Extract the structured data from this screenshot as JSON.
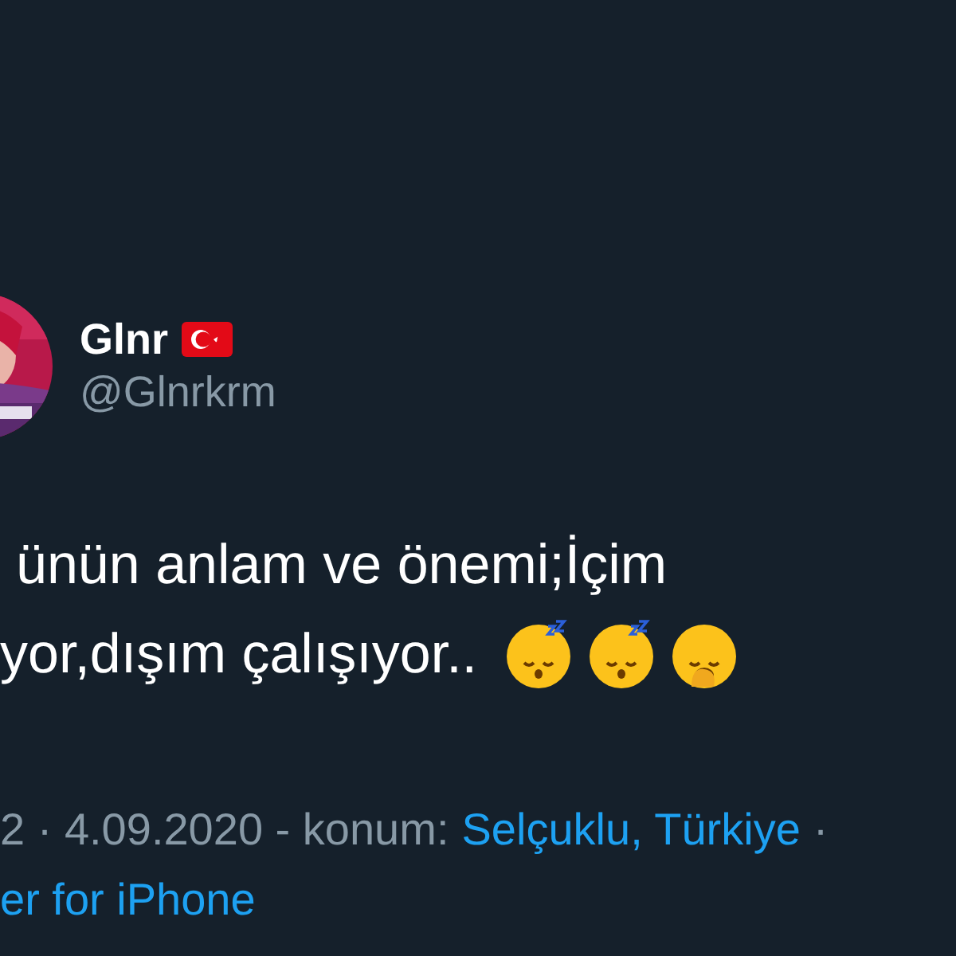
{
  "author": {
    "name": "Glnr",
    "handle": "@Glnrkrm"
  },
  "tweet": {
    "lines": [
      {
        "text": "ünün anlam ve önemi;İçim"
      },
      {
        "text": "yor,dışım çalışıyor..",
        "emoji": [
          {
            "kind": "sleeping"
          },
          {
            "kind": "sleeping"
          },
          {
            "kind": "yawning"
          }
        ]
      }
    ]
  },
  "meta": {
    "lines": [
      [
        {
          "text": "2 · 4.09.2020 - konum:",
          "kind": "plain"
        },
        {
          "text": "Selçuklu, Türkiye",
          "kind": "link"
        },
        {
          "text": "·",
          "kind": "plain"
        }
      ],
      [
        {
          "text": "er for iPhone",
          "kind": "link"
        }
      ]
    ]
  }
}
